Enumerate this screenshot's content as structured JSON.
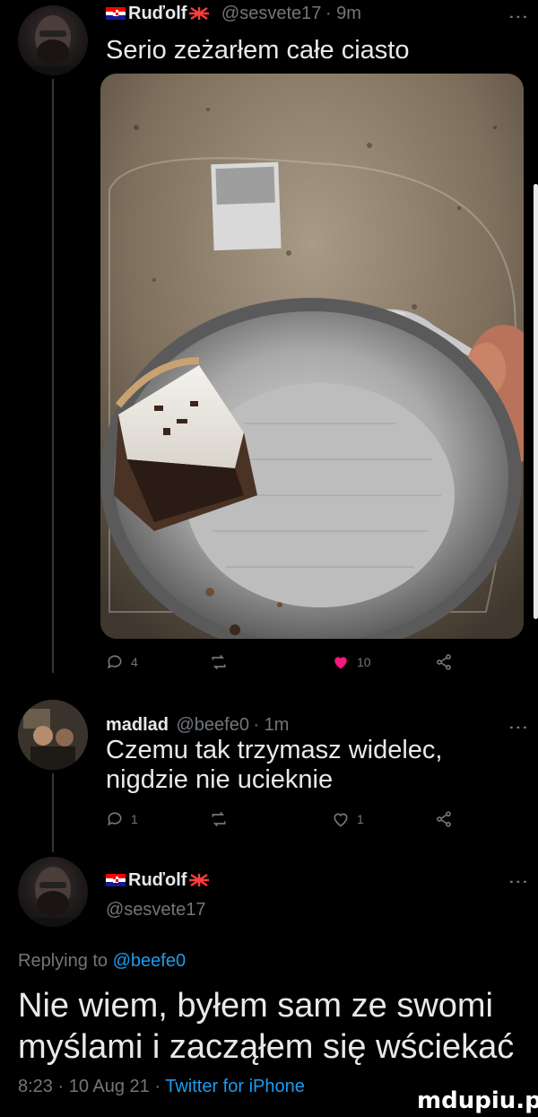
{
  "tweets": [
    {
      "display_name": "Ruďolf",
      "handle": "@sesvete17",
      "time": "9m",
      "text": "Serio zeżarłem całe ciasto",
      "actions": {
        "replies": "4",
        "likes": "10"
      }
    },
    {
      "display_name": "madlad",
      "handle": "@beefe0",
      "time": "1m",
      "text_line1": "Czemu tak trzymasz widelec,",
      "text_line2": "nigdzie nie ucieknie",
      "actions": {
        "replies": "1",
        "likes": "1"
      }
    },
    {
      "display_name": "Ruďolf",
      "handle": "@sesvete17",
      "replying_prefix": "Replying to",
      "replying_to": "@beefe0",
      "text_line1": "Nie wiem, byłem sam ze swomi",
      "text_line2": "myślami i zacząłem się wściekać",
      "timestamp": "8:23 · 10 Aug 21 ·",
      "source": "Twitter for iPhone"
    }
  ],
  "watermark": "mdupiu.pl",
  "colors": {
    "like_red": "#f91880",
    "link_blue": "#1d9bf0",
    "muted": "#71767b"
  }
}
